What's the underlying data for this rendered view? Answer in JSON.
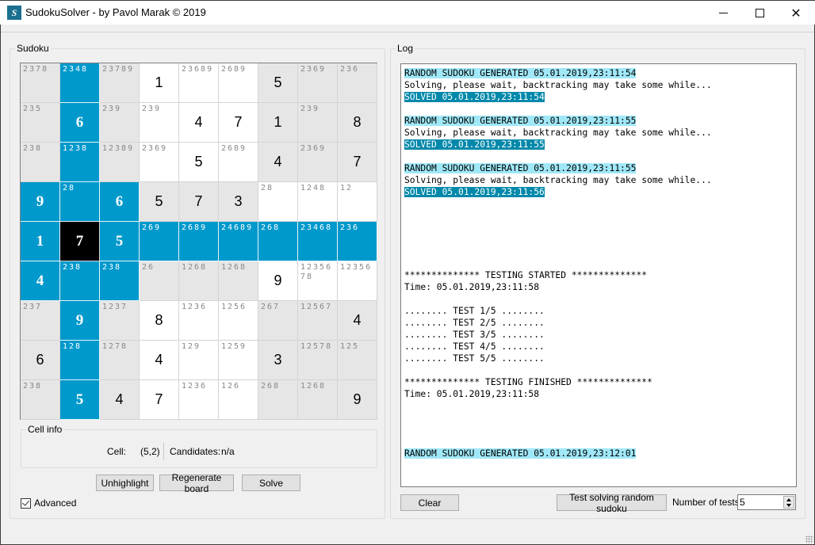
{
  "window": {
    "title": "SudokuSolver - by Pavol Marak © 2019",
    "icon": "sudoku-app-icon",
    "controls": [
      "minimize",
      "maximize",
      "close"
    ]
  },
  "sudoku_group": {
    "label": "Sudoku",
    "board": [
      [
        {
          "c": "2378",
          "bg": "gray"
        },
        {
          "c": "2348",
          "bg": "blue"
        },
        {
          "c": "23789",
          "bg": "gray"
        },
        {
          "v": "1",
          "bg": "white"
        },
        {
          "c": "23689",
          "bg": "white"
        },
        {
          "c": "2689",
          "bg": "white"
        },
        {
          "v": "5",
          "bg": "gray"
        },
        {
          "c": "2369",
          "bg": "gray"
        },
        {
          "c": "236",
          "bg": "gray"
        }
      ],
      [
        {
          "c": "235",
          "bg": "gray"
        },
        {
          "v": "6",
          "bg": "blue"
        },
        {
          "c": "239",
          "bg": "gray"
        },
        {
          "c": "239",
          "bg": "white"
        },
        {
          "v": "4",
          "bg": "white"
        },
        {
          "v": "7",
          "bg": "white"
        },
        {
          "v": "1",
          "bg": "gray"
        },
        {
          "c": "239",
          "bg": "gray"
        },
        {
          "v": "8",
          "bg": "gray"
        }
      ],
      [
        {
          "c": "238",
          "bg": "gray"
        },
        {
          "c": "1238",
          "bg": "blue"
        },
        {
          "c": "12389",
          "bg": "gray"
        },
        {
          "c": "2369",
          "bg": "white"
        },
        {
          "v": "5",
          "bg": "white"
        },
        {
          "c": "2689",
          "bg": "white"
        },
        {
          "v": "4",
          "bg": "gray"
        },
        {
          "c": "2369",
          "bg": "gray"
        },
        {
          "v": "7",
          "bg": "gray"
        }
      ],
      [
        {
          "v": "9",
          "bg": "blue"
        },
        {
          "c": "28",
          "bg": "blue"
        },
        {
          "v": "6",
          "bg": "blue"
        },
        {
          "v": "5",
          "bg": "gray"
        },
        {
          "v": "7",
          "bg": "gray"
        },
        {
          "v": "3",
          "bg": "gray"
        },
        {
          "c": "28",
          "bg": "white"
        },
        {
          "c": "1248",
          "bg": "white"
        },
        {
          "c": "12",
          "bg": "white"
        }
      ],
      [
        {
          "v": "1",
          "bg": "blue"
        },
        {
          "v": "7",
          "bg": "black"
        },
        {
          "v": "5",
          "bg": "blue"
        },
        {
          "c": "269",
          "bg": "blue"
        },
        {
          "c": "2689",
          "bg": "blue"
        },
        {
          "c": "24689",
          "bg": "blue"
        },
        {
          "c": "268",
          "bg": "blue"
        },
        {
          "c": "23468",
          "bg": "blue"
        },
        {
          "c": "236",
          "bg": "blue"
        }
      ],
      [
        {
          "v": "4",
          "bg": "blue"
        },
        {
          "c": "238",
          "bg": "blue"
        },
        {
          "c": "238",
          "bg": "blue"
        },
        {
          "c": "26",
          "bg": "gray"
        },
        {
          "c": "1268",
          "bg": "gray"
        },
        {
          "c": "1268",
          "bg": "gray"
        },
        {
          "v": "9",
          "bg": "white"
        },
        {
          "c": "1235678",
          "bg": "white"
        },
        {
          "c": "12356",
          "bg": "white"
        }
      ],
      [
        {
          "c": "237",
          "bg": "gray"
        },
        {
          "v": "9",
          "bg": "blue"
        },
        {
          "c": "1237",
          "bg": "gray"
        },
        {
          "v": "8",
          "bg": "white"
        },
        {
          "c": "1236",
          "bg": "white"
        },
        {
          "c": "1256",
          "bg": "white"
        },
        {
          "c": "267",
          "bg": "gray"
        },
        {
          "c": "12567",
          "bg": "gray"
        },
        {
          "v": "4",
          "bg": "gray"
        }
      ],
      [
        {
          "v": "6",
          "bg": "gray"
        },
        {
          "c": "128",
          "bg": "blue"
        },
        {
          "c": "1278",
          "bg": "gray"
        },
        {
          "v": "4",
          "bg": "white"
        },
        {
          "c": "129",
          "bg": "white"
        },
        {
          "c": "1259",
          "bg": "white"
        },
        {
          "v": "3",
          "bg": "gray"
        },
        {
          "c": "12578",
          "bg": "gray"
        },
        {
          "c": "125",
          "bg": "gray"
        }
      ],
      [
        {
          "c": "238",
          "bg": "gray"
        },
        {
          "v": "5",
          "bg": "blue"
        },
        {
          "v": "4",
          "bg": "gray"
        },
        {
          "v": "7",
          "bg": "white"
        },
        {
          "c": "1236",
          "bg": "white"
        },
        {
          "c": "126",
          "bg": "white"
        },
        {
          "c": "268",
          "bg": "gray"
        },
        {
          "c": "1268",
          "bg": "gray"
        },
        {
          "v": "9",
          "bg": "gray"
        }
      ]
    ],
    "colors": {
      "highlight": "#0099cc",
      "selected": "#000000",
      "box_shade": "#e6e6e6",
      "box_plain": "#ffffff"
    },
    "cell_info": {
      "label": "Cell info",
      "cell_label": "Cell:",
      "cell_value": "(5,2)",
      "candidates_label": "Candidates:",
      "candidates_value": "n/a"
    },
    "buttons": {
      "unhighlight": "Unhighlight",
      "regenerate": "Regenerate board",
      "solve": "Solve"
    },
    "advanced": {
      "label": "Advanced",
      "checked": true
    }
  },
  "log_group": {
    "label": "Log",
    "lines": [
      {
        "text": "RANDOM SUDOKU GENERATED 05.01.2019,23:11:54",
        "style": "gen"
      },
      {
        "text": "Solving, please wait, backtracking may take some while...",
        "style": ""
      },
      {
        "text": "SOLVED 05.01.2019,23:11:54",
        "style": "solved"
      },
      {
        "text": "",
        "style": ""
      },
      {
        "text": "RANDOM SUDOKU GENERATED 05.01.2019,23:11:55",
        "style": "gen"
      },
      {
        "text": "Solving, please wait, backtracking may take some while...",
        "style": ""
      },
      {
        "text": "SOLVED 05.01.2019,23:11:55",
        "style": "solved"
      },
      {
        "text": "",
        "style": ""
      },
      {
        "text": "RANDOM SUDOKU GENERATED 05.01.2019,23:11:55",
        "style": "gen"
      },
      {
        "text": "Solving, please wait, backtracking may take some while...",
        "style": ""
      },
      {
        "text": "SOLVED 05.01.2019,23:11:56",
        "style": "solved"
      },
      {
        "text": "",
        "style": ""
      },
      {
        "text": "",
        "style": ""
      },
      {
        "text": "",
        "style": ""
      },
      {
        "text": "",
        "style": ""
      },
      {
        "text": "",
        "style": ""
      },
      {
        "text": "",
        "style": ""
      },
      {
        "text": "************** TESTING STARTED **************",
        "style": ""
      },
      {
        "text": "Time: 05.01.2019,23:11:58",
        "style": ""
      },
      {
        "text": "",
        "style": ""
      },
      {
        "text": "........ TEST 1/5 ........",
        "style": ""
      },
      {
        "text": "........ TEST 2/5 ........",
        "style": ""
      },
      {
        "text": "........ TEST 3/5 ........",
        "style": ""
      },
      {
        "text": "........ TEST 4/5 ........",
        "style": ""
      },
      {
        "text": "........ TEST 5/5 ........",
        "style": ""
      },
      {
        "text": "",
        "style": ""
      },
      {
        "text": "************** TESTING FINISHED **************",
        "style": ""
      },
      {
        "text": "Time: 05.01.2019,23:11:58",
        "style": ""
      },
      {
        "text": "",
        "style": ""
      },
      {
        "text": "",
        "style": ""
      },
      {
        "text": "",
        "style": ""
      },
      {
        "text": "",
        "style": ""
      },
      {
        "text": "RANDOM SUDOKU GENERATED 05.01.2019,23:12:01",
        "style": "gen"
      }
    ],
    "colors": {
      "generated_bg": "#a0e8f8",
      "solved_bg": "#0088aa"
    },
    "buttons": {
      "clear": "Clear",
      "test": "Test solving random sudoku"
    },
    "number_of_tests": {
      "label": "Number of tests",
      "value": "5"
    }
  }
}
